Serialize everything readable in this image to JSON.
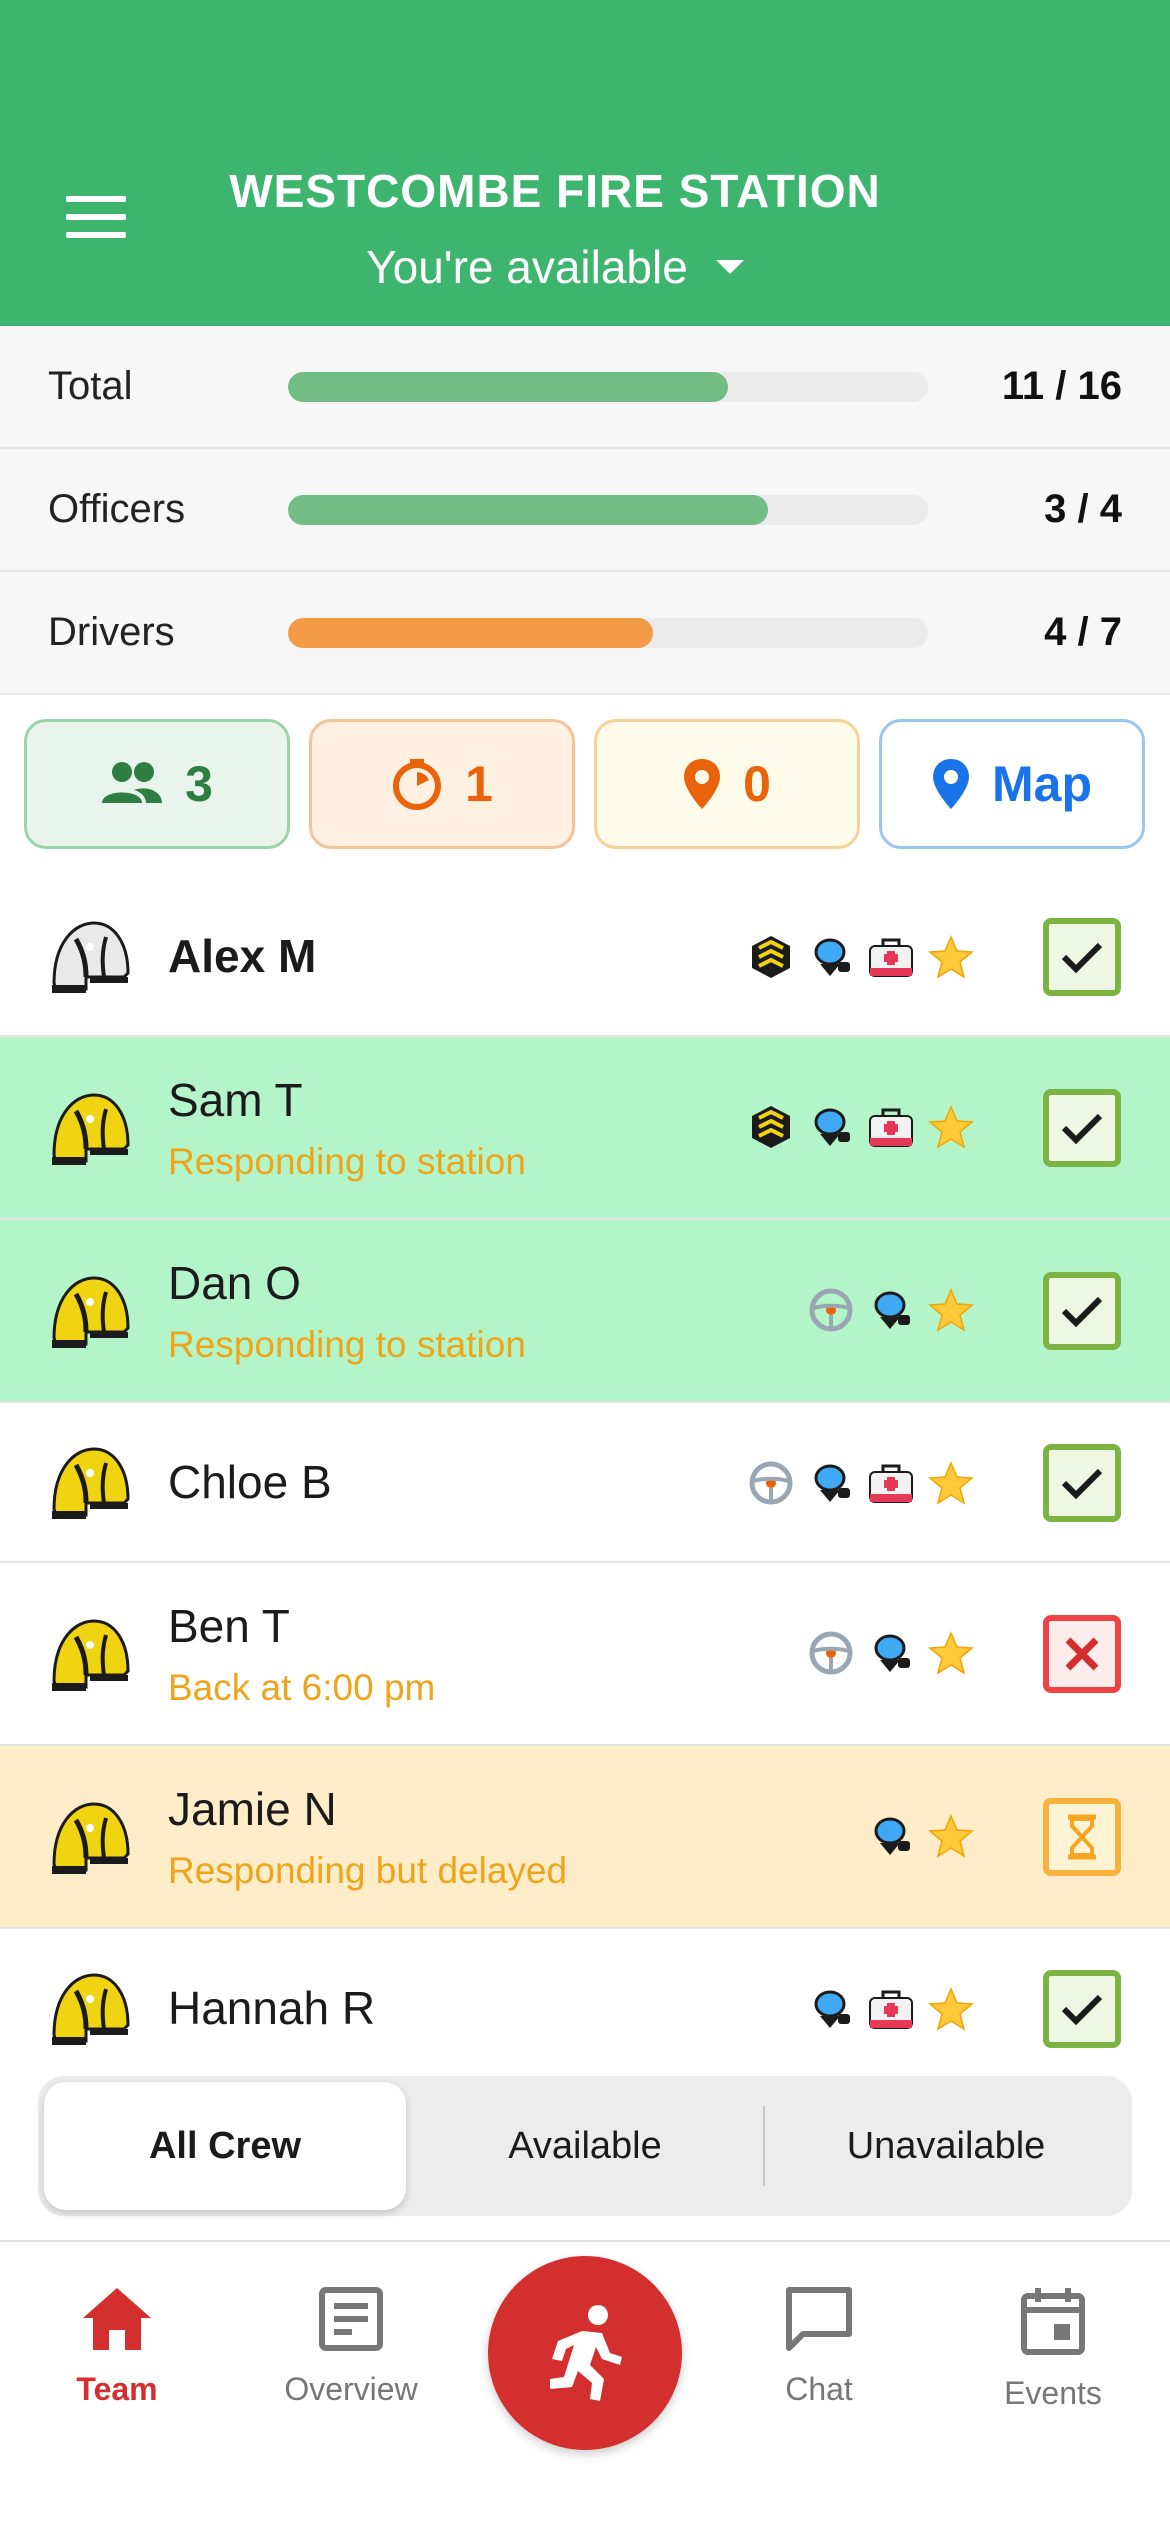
{
  "header": {
    "station_name": "WESTCOMBE FIRE STATION",
    "availability": "You're available",
    "bg_color": "#3db56f"
  },
  "stats": [
    {
      "label": "Total",
      "value": "11 / 16",
      "fraction": 0.6875,
      "color": "#72bd86"
    },
    {
      "label": "Officers",
      "value": "3 / 4",
      "fraction": 0.75,
      "color": "#72bd86"
    },
    {
      "label": "Drivers",
      "value": "4 / 7",
      "fraction": 0.571,
      "color": "#f29a45"
    }
  ],
  "chips": {
    "crew": {
      "count": "3",
      "icon": "people-icon"
    },
    "responding": {
      "count": "1",
      "icon": "timer-icon"
    },
    "location": {
      "count": "0",
      "icon": "location-pin-icon"
    },
    "map": {
      "label": "Map",
      "icon": "map-pin-icon"
    }
  },
  "crew": [
    {
      "name": "Alex M",
      "status": "",
      "helmet": "white",
      "quals": [
        "officer",
        "breathing-apparatus",
        "medical",
        "star"
      ],
      "state": "available"
    },
    {
      "name": "Sam T",
      "status": "Responding to station",
      "helmet": "yellow",
      "quals": [
        "officer",
        "breathing-apparatus",
        "medical",
        "star"
      ],
      "state": "available"
    },
    {
      "name": "Dan O",
      "status": "Responding to station",
      "helmet": "yellow",
      "quals": [
        "driver",
        "breathing-apparatus",
        "star"
      ],
      "state": "available"
    },
    {
      "name": "Chloe B",
      "status": "",
      "helmet": "yellow",
      "quals": [
        "driver",
        "breathing-apparatus",
        "medical",
        "star"
      ],
      "state": "available"
    },
    {
      "name": "Ben T",
      "status": "Back at 6:00 pm",
      "helmet": "yellow",
      "quals": [
        "driver",
        "breathing-apparatus",
        "star"
      ],
      "state": "unavailable"
    },
    {
      "name": "Jamie N",
      "status": "Responding but delayed",
      "helmet": "yellow",
      "quals": [
        "breathing-apparatus",
        "star"
      ],
      "state": "delayed"
    },
    {
      "name": "Hannah R",
      "status": "",
      "helmet": "yellow",
      "quals": [
        "breathing-apparatus",
        "medical",
        "star"
      ],
      "state": "available"
    }
  ],
  "filters": {
    "all": "All Crew",
    "available": "Available",
    "unavailable": "Unavailable"
  },
  "nav": {
    "team": "Team",
    "overview": "Overview",
    "chat": "Chat",
    "events": "Events"
  }
}
